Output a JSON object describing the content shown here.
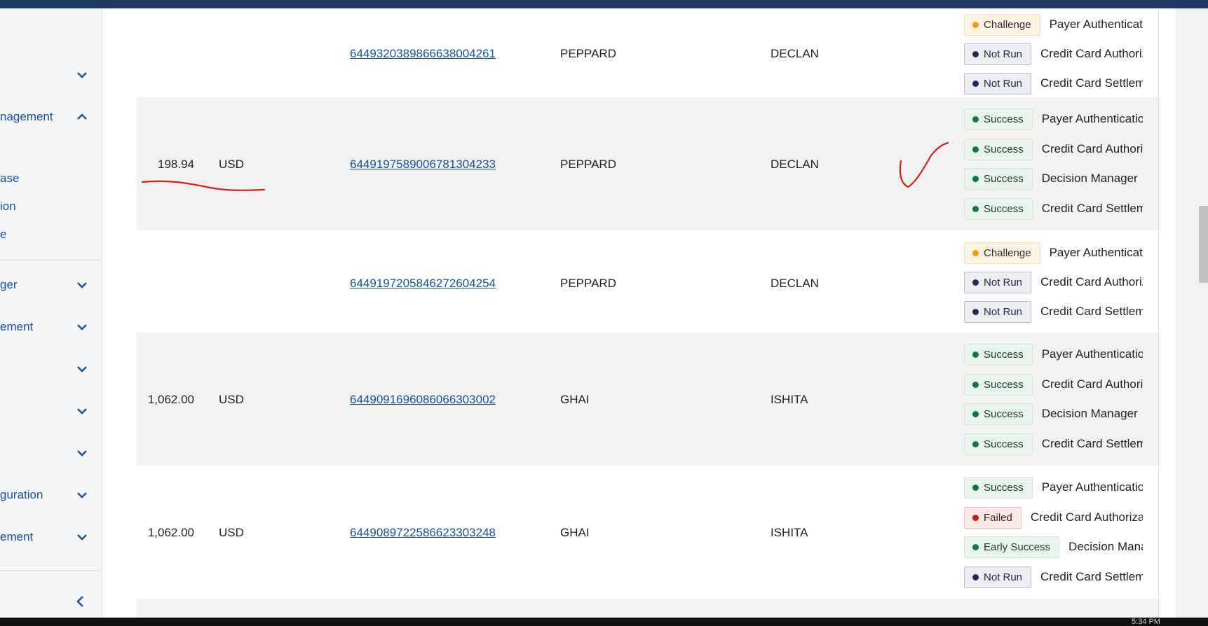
{
  "sidebar": {
    "groups": [
      {
        "label": "",
        "expanded": false
      },
      {
        "label": "nagement",
        "expanded": true
      },
      {
        "label": "ger",
        "expanded": false
      },
      {
        "label": "ement",
        "expanded": false
      },
      {
        "label": "",
        "expanded": false
      },
      {
        "label": "",
        "expanded": false
      },
      {
        "label": "",
        "expanded": false
      },
      {
        "label": "guration",
        "expanded": false
      },
      {
        "label": "ement",
        "expanded": false
      }
    ],
    "sub_items": [
      "ase",
      "ion",
      "e"
    ]
  },
  "transactions": [
    {
      "amount": "",
      "currency": "",
      "request_id": "6449320389866638004261",
      "last_name": "PEPPARD",
      "first_name": "DECLAN",
      "checks": [
        {
          "status": "Challenge",
          "kind": "challenge",
          "name": "Payer Authentication"
        },
        {
          "status": "Not Run",
          "kind": "notrun",
          "name": "Credit Card Authorization"
        },
        {
          "status": "Not Run",
          "kind": "notrun",
          "name": "Credit Card Settlement"
        }
      ]
    },
    {
      "amount": "198.94",
      "currency": "USD",
      "request_id": "6449197589006781304233",
      "last_name": "PEPPARD",
      "first_name": "DECLAN",
      "checks": [
        {
          "status": "Success",
          "kind": "success",
          "name": "Payer Authentication"
        },
        {
          "status": "Success",
          "kind": "success",
          "name": "Credit Card Authorization"
        },
        {
          "status": "Success",
          "kind": "success",
          "name": "Decision Manager"
        },
        {
          "status": "Success",
          "kind": "success",
          "name": "Credit Card Settlement"
        }
      ]
    },
    {
      "amount": "",
      "currency": "",
      "request_id": "6449197205846272604254",
      "last_name": "PEPPARD",
      "first_name": "DECLAN",
      "checks": [
        {
          "status": "Challenge",
          "kind": "challenge",
          "name": "Payer Authentication"
        },
        {
          "status": "Not Run",
          "kind": "notrun",
          "name": "Credit Card Authorization"
        },
        {
          "status": "Not Run",
          "kind": "notrun",
          "name": "Credit Card Settlement"
        }
      ]
    },
    {
      "amount": "1,062.00",
      "currency": "USD",
      "request_id": "6449091696086066303002",
      "last_name": "GHAI",
      "first_name": "ISHITA",
      "checks": [
        {
          "status": "Success",
          "kind": "success",
          "name": "Payer Authentication"
        },
        {
          "status": "Success",
          "kind": "success",
          "name": "Credit Card Authorization"
        },
        {
          "status": "Success",
          "kind": "success",
          "name": "Decision Manager"
        },
        {
          "status": "Success",
          "kind": "success",
          "name": "Credit Card Settlement"
        }
      ]
    },
    {
      "amount": "1,062.00",
      "currency": "USD",
      "request_id": "6449089722586623303248",
      "last_name": "GHAI",
      "first_name": "ISHITA",
      "checks": [
        {
          "status": "Success",
          "kind": "success",
          "name": "Payer Authentication"
        },
        {
          "status": "Failed",
          "kind": "failed",
          "name": "Credit Card Authorization"
        },
        {
          "status": "Early Success",
          "kind": "success",
          "name": "Decision Manager"
        },
        {
          "status": "Not Run",
          "kind": "notrun",
          "name": "Credit Card Settlement"
        }
      ]
    }
  ],
  "taskbar": {
    "time": "5:34 PM"
  },
  "colors": {
    "link": "#1a4fa0",
    "success": "#0c7a3e",
    "challenge": "#f29b12",
    "failed": "#d41616",
    "notrun": "#1e2a5a",
    "annotation": "#e01b1b"
  }
}
